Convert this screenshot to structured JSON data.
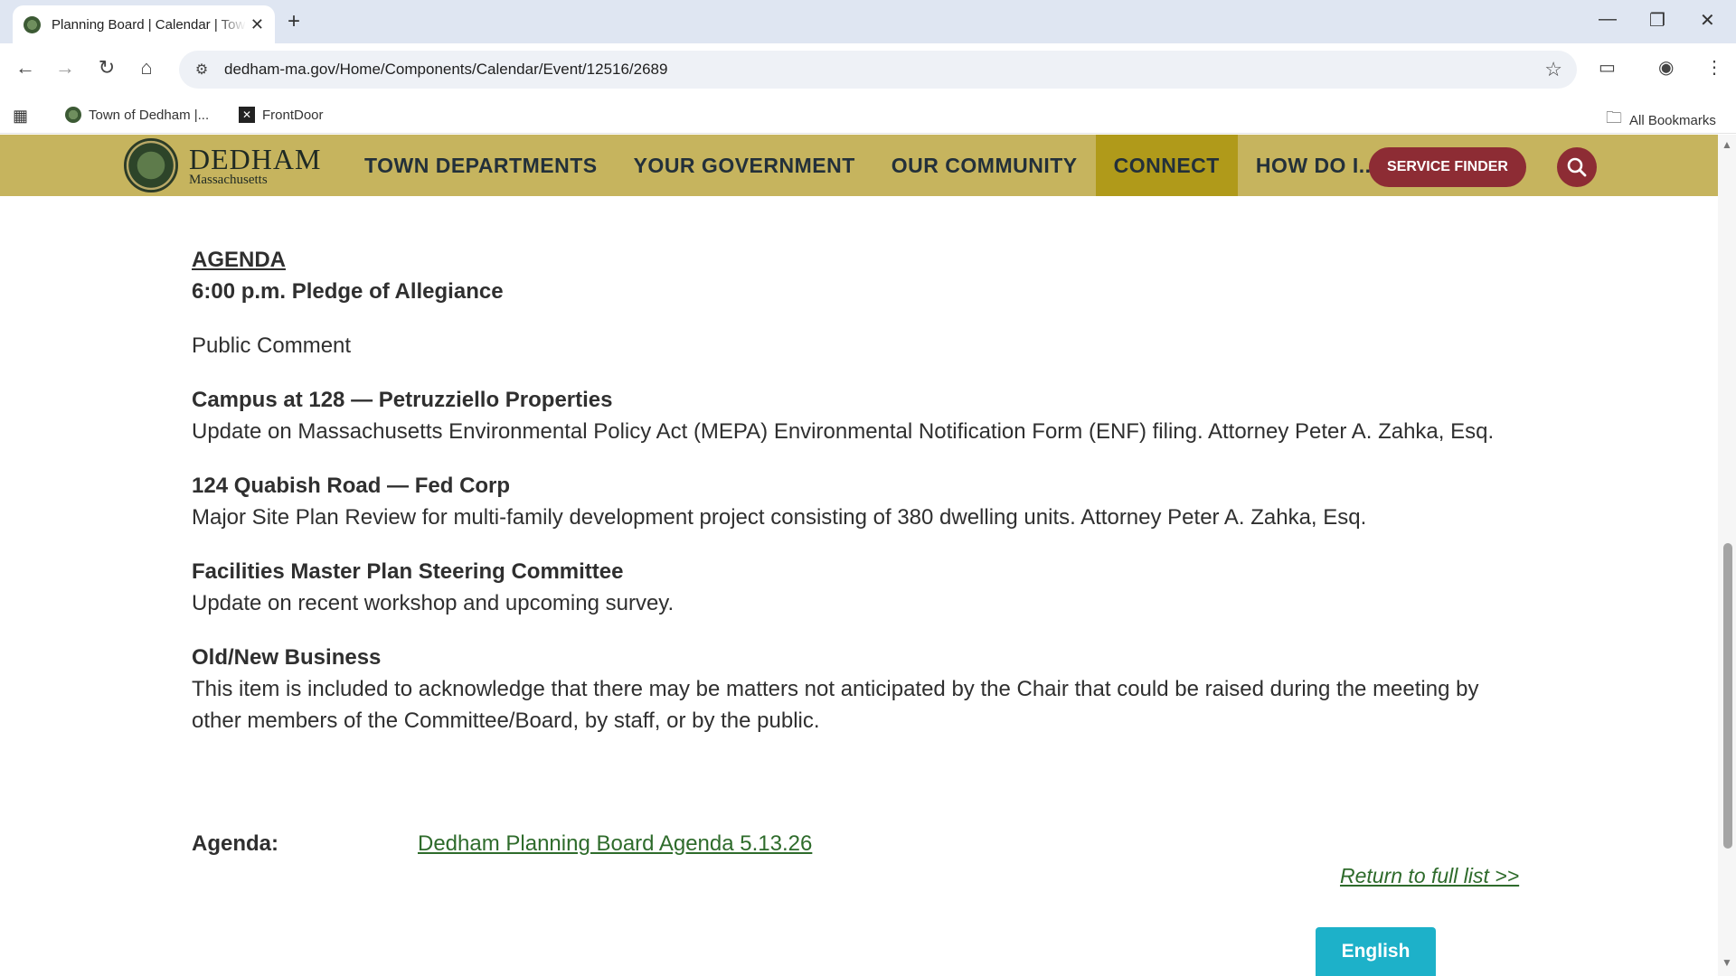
{
  "browser": {
    "tab_title": "Planning Board | Calendar | Town of Dedham",
    "url": "dedham-ma.gov/Home/Components/Calendar/Event/12516/2689",
    "bookmarks": [
      {
        "label": "Town of Dedham |..."
      },
      {
        "label": "FrontDoor"
      }
    ],
    "all_bookmarks_label": "All Bookmarks"
  },
  "site": {
    "logo_name": "DEDHAM",
    "logo_sub": "Massachusetts",
    "nav": [
      {
        "label": "TOWN DEPARTMENTS"
      },
      {
        "label": "YOUR GOVERNMENT"
      },
      {
        "label": "OUR COMMUNITY"
      },
      {
        "label": "CONNECT"
      },
      {
        "label": "HOW DO I..."
      }
    ],
    "service_finder": "SERVICE FINDER"
  },
  "content": {
    "agenda_heading": "AGENDA",
    "pledge": "6:00 p.m. Pledge of Allegiance",
    "public_comment": "Public Comment",
    "items": [
      {
        "title": "Campus at 128 — Petruzziello Properties",
        "text": "Update on Massachusetts Environmental Policy Act (MEPA) Environmental Notification Form (ENF) filing. Attorney Peter A. Zahka, Esq."
      },
      {
        "title": "124 Quabish Road — Fed Corp",
        "text": "Major Site Plan Review for multi-family development project consisting of 380 dwelling units. Attorney Peter A. Zahka, Esq."
      },
      {
        "title": "Facilities Master Plan Steering Committee",
        "text": "Update on recent workshop and upcoming survey."
      },
      {
        "title": "Old/New Business",
        "text": "This item is included to acknowledge that there may be matters not anticipated by the Chair that could be raised during the meeting by other members of the Committee/Board, by staff, or by the public."
      }
    ],
    "agenda_label": "Agenda:",
    "agenda_link": "Dedham Planning Board Agenda 5.13.26",
    "return_link": "Return to full list >>",
    "language_button": "English"
  },
  "colors": {
    "header_bg": "#c6b45e",
    "active_nav_bg": "#b09a1a",
    "service_button": "#8d2c34",
    "link": "#2e6b2b",
    "language_button": "#1db1c9"
  }
}
